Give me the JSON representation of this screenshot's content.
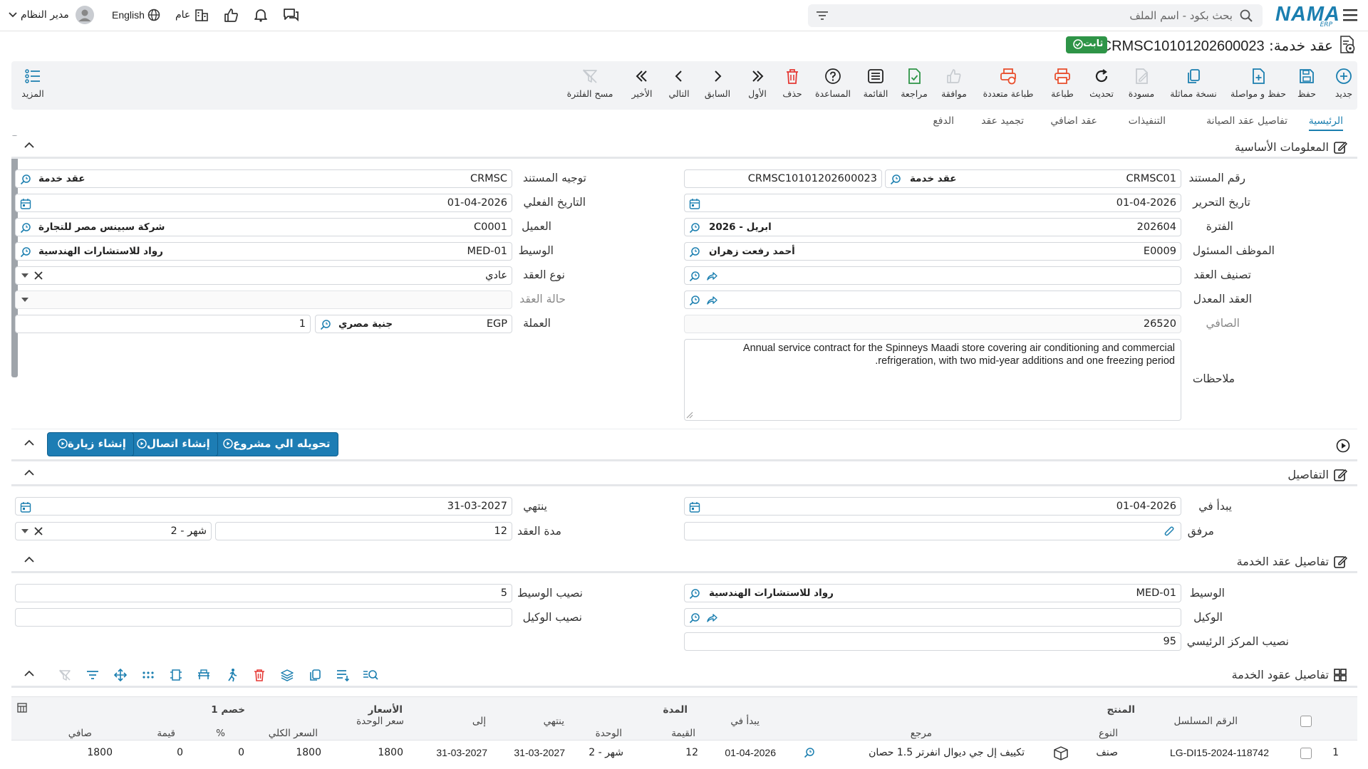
{
  "colors": {
    "brand": "#1b7fb0",
    "accent_blue": "#1d7db4",
    "success_green": "#2e9447",
    "danger_red": "#e53935"
  },
  "topbar": {
    "logo": "NAMA",
    "logo_sub": "ERP",
    "search_placeholder": "بحث بكود - اسم الملف",
    "user": "مدير النظام",
    "language": "English",
    "scope": "عام"
  },
  "title": {
    "prefix": "عقد خدمة:",
    "doc_no": "CRMSC10101202600023",
    "status": "ثابت"
  },
  "toolbar": [
    {
      "key": "new",
      "label": "جديد",
      "icon": "plus-circle-icon"
    },
    {
      "key": "save",
      "label": "حفظ",
      "icon": "save-icon"
    },
    {
      "key": "save_continue",
      "label": "حفظ و مواصلة",
      "icon": "file-plus-icon"
    },
    {
      "key": "copy",
      "label": "نسخة مماثلة",
      "icon": "copy-icon"
    },
    {
      "key": "draft",
      "label": "مسودة",
      "icon": "draft-icon"
    },
    {
      "key": "refresh",
      "label": "تحديث",
      "icon": "refresh-icon"
    },
    {
      "key": "print",
      "label": "طباعة",
      "icon": "print-icon"
    },
    {
      "key": "multi_print",
      "label": "طباعة متعددة",
      "icon": "multi-print-icon"
    },
    {
      "key": "approve",
      "label": "موافقة",
      "icon": "thumbs-up-icon"
    },
    {
      "key": "review",
      "label": "مراجعة",
      "icon": "review-icon"
    },
    {
      "key": "list",
      "label": "القائمة",
      "icon": "list-icon"
    },
    {
      "key": "help",
      "label": "المساعدة",
      "icon": "help-icon"
    },
    {
      "key": "delete",
      "label": "حذف",
      "icon": "trash-icon"
    },
    {
      "key": "first",
      "label": "الأول",
      "icon": "first-icon"
    },
    {
      "key": "prev",
      "label": "السابق",
      "icon": "prev-icon"
    },
    {
      "key": "next",
      "label": "التالي",
      "icon": "next-icon"
    },
    {
      "key": "last",
      "label": "الأخير",
      "icon": "last-icon"
    },
    {
      "key": "clear_filter",
      "label": "مسح الفلترة",
      "icon": "clear-filter-icon"
    }
  ],
  "more": "المزيد",
  "tabs": [
    "الرئيسية",
    "تفاصيل عقد الصيانة",
    "التنفيذات",
    "عقد اضافي",
    "تجميد عقد",
    "الدفع"
  ],
  "sections": {
    "basic": "المعلومات الأساسية",
    "details": "التفاصيل",
    "service_details": "تفاصيل عقد الخدمة",
    "service_lines": "تفاصيل عقود الخدمة"
  },
  "basic": {
    "doc_number": {
      "label": "رقم المستند",
      "code": "CRMSC01",
      "name": "عقد خدمة",
      "value": "CRMSC10101202600023"
    },
    "doc_direction": {
      "label": "توجيه المستند",
      "code": "CRMSC",
      "name": "عقد خدمة"
    },
    "edit_date": {
      "label": "تاريخ التحرير",
      "value": "01-04-2026"
    },
    "actual_date": {
      "label": "التاريخ الفعلي",
      "value": "01-04-2026"
    },
    "period": {
      "label": "الفترة",
      "code": "202604",
      "name": "2026 - ابريل"
    },
    "customer": {
      "label": "العميل",
      "code": "C0001",
      "name": "شركة سبينس مصر للتجارة"
    },
    "employee": {
      "label": "الموظف المسئول",
      "code": "E0009",
      "name": "أحمد رفعت زهران"
    },
    "broker": {
      "label": "الوسيط",
      "code": "MED-01",
      "name": "رواد للاستشارات الهندسية"
    },
    "contract_class": {
      "label": "تصنيف العقد",
      "value": ""
    },
    "contract_type": {
      "label": "نوع العقد",
      "value": "عادي"
    },
    "amended_contract": {
      "label": "العقد المعدل",
      "value": ""
    },
    "contract_status": {
      "label": "حالة العقد",
      "value": ""
    },
    "net": {
      "label": "الصافي",
      "value": "26520"
    },
    "currency": {
      "label": "العملة",
      "code": "EGP",
      "name": "جنية مصري",
      "rate": "1"
    },
    "notes": {
      "label": "ملاحظات",
      "value": "Annual service contract for the Spinneys Maadi store covering air conditioning and commercial refrigeration, with two mid-year additions and one freezing period."
    }
  },
  "actions": [
    "تحويله الي مشروع",
    "إنشاء اتصال",
    "إنشاء زيارة"
  ],
  "details": {
    "starts": {
      "label": "يبدأ في",
      "value": "01-04-2026"
    },
    "ends": {
      "label": "ينتهي",
      "value": "31-03-2027"
    },
    "attachment": {
      "label": "مرفق",
      "value": ""
    },
    "duration": {
      "label": "مدة العقد",
      "value": "12",
      "unit": "2 - شهر"
    }
  },
  "service": {
    "broker": {
      "label": "الوسيط",
      "code": "MED-01",
      "name": "رواد للاستشارات الهندسية"
    },
    "broker_share": {
      "label": "نصيب الوسيط",
      "value": "5"
    },
    "agent": {
      "label": "الوكيل",
      "value": ""
    },
    "agent_share": {
      "label": "نصيب الوكيل",
      "value": ""
    },
    "main_center_share": {
      "label": "نصيب المركز الرئيسي",
      "value": "95"
    }
  },
  "grid": {
    "groups": {
      "product": "المنتج",
      "duration": "المدة",
      "prices": "الأسعار",
      "discount": "خصم 1"
    },
    "headers": {
      "serial": "الرقم المسلسل",
      "type": "النوع",
      "ref": "مرجع",
      "starts": "يبدأ في",
      "value": "القيمة",
      "unit": "الوحدة",
      "ends": "ينتهي",
      "to": "إلى",
      "unit_price": "سعر الوحدة",
      "total_price": "السعر الكلي",
      "pct": "%",
      "disc_value": "قيمة",
      "net": "صافي"
    },
    "rows": [
      {
        "no": "1",
        "serial": "LG-DI15-2024-118742",
        "type": "صنف",
        "ref": "تكييف إل جي ديوال انفرتر 1.5 حصان",
        "starts": "01-04-2026",
        "value": "12",
        "unit": "2 - شهر",
        "ends": "31-03-2027",
        "to": "31-03-2027",
        "unit_price": "1800",
        "total_price": "1800",
        "pct": "0",
        "disc_value": "0",
        "net": "1800"
      }
    ]
  }
}
